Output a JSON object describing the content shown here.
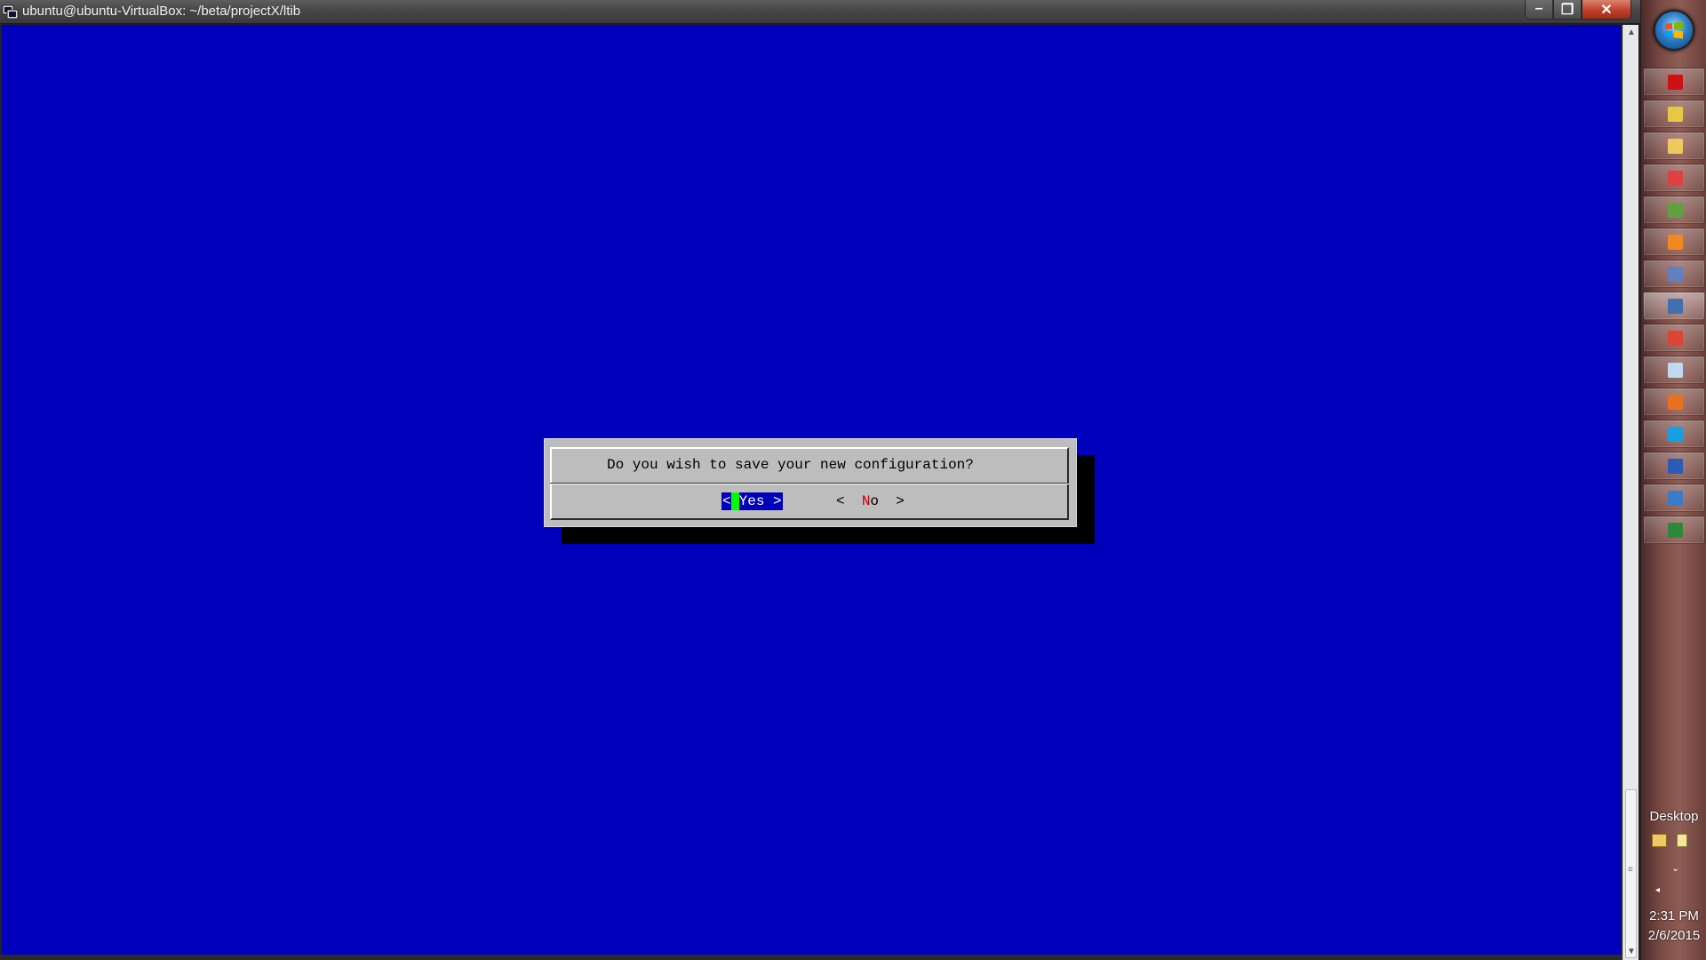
{
  "window": {
    "title": "ubuntu@ubuntu-VirtualBox: ~/beta/projectX/ltib",
    "controls": {
      "minimize": "–",
      "maximize": "❐",
      "close": "✕"
    }
  },
  "terminal": {
    "background": "#0000bc",
    "scrollbar": {
      "thumb_grip": "≡",
      "up": "▲",
      "down": "▼"
    }
  },
  "dialog": {
    "message": "Do you wish to save your new configuration?",
    "yes_button": {
      "left": "<",
      "label": "Yes >"
    },
    "no_button": {
      "left": "<  ",
      "hotkey": "N",
      "rest": "o",
      "right": "  >"
    },
    "selected": "Yes"
  },
  "taskbar": {
    "items": [
      {
        "name": "adobe-reader-icon",
        "color": "#d01010"
      },
      {
        "name": "notes-icon",
        "color": "#e8c840"
      },
      {
        "name": "explorer-icon",
        "color": "#f0c860"
      },
      {
        "name": "calculator-icon",
        "color": "#e04040"
      },
      {
        "name": "image-viewer-icon",
        "color": "#60a040"
      },
      {
        "name": "outlook-icon",
        "color": "#f08a20"
      },
      {
        "name": "virtualbox-icon",
        "color": "#6080c0"
      },
      {
        "name": "putty-icon",
        "color": "#4070b0"
      },
      {
        "name": "chrome-icon",
        "color": "#dd4433"
      },
      {
        "name": "document-icon",
        "color": "#c0d8f0"
      },
      {
        "name": "firefox-icon",
        "color": "#e87020"
      },
      {
        "name": "skype-icon",
        "color": "#1aa0e0"
      },
      {
        "name": "word-icon",
        "color": "#2a5cb8"
      },
      {
        "name": "remote-desktop-icon",
        "color": "#3a7cc8"
      },
      {
        "name": "excel-icon",
        "color": "#2a8a3a"
      }
    ],
    "desktop_label": "Desktop",
    "clock": {
      "time": "2:31 PM",
      "date": "2/6/2015"
    },
    "tray": {
      "show_hidden": "⌄",
      "arrow": "◂"
    }
  }
}
